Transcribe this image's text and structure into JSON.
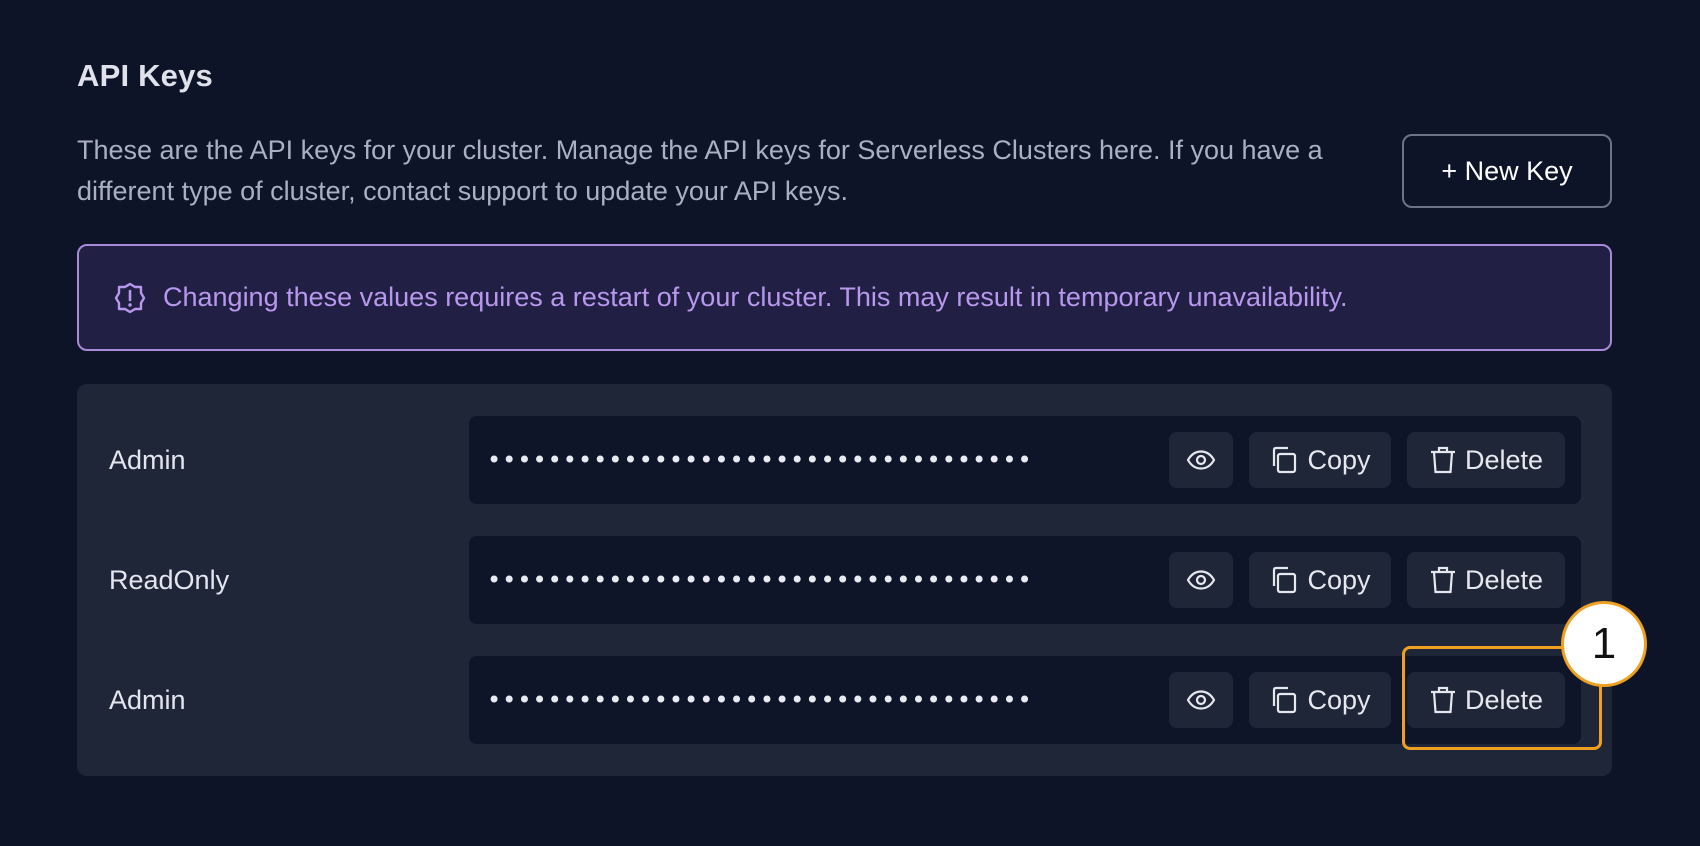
{
  "header": {
    "title": "API Keys",
    "description": "These are the API keys for your cluster. Manage the API keys for Serverless Clusters here. If you have a different type of cluster, contact support to update your API keys.",
    "new_key_label": "+ New Key"
  },
  "alert": {
    "text": "Changing these values requires a restart of your cluster. This may result in temporary unavailability.",
    "icon": "alert-circle-icon",
    "color": "#b898ec"
  },
  "keys": [
    {
      "label": "Admin",
      "masked_value": "••••••••••••••••••••••••••••••••••••",
      "copy_label": "Copy",
      "delete_label": "Delete"
    },
    {
      "label": "ReadOnly",
      "masked_value": "••••••••••••••••••••••••••••••••••••",
      "copy_label": "Copy",
      "delete_label": "Delete"
    },
    {
      "label": "Admin",
      "masked_value": "••••••••••••••••••••••••••••••••••••",
      "copy_label": "Copy",
      "delete_label": "Delete"
    }
  ],
  "annotation": {
    "callout_number": "1",
    "color": "#f0a020"
  },
  "colors": {
    "background": "#0e1428",
    "panel": "#1f2638",
    "field": "#0f1528",
    "alert_border": "#a88ad8",
    "alert_background": "#221f45"
  }
}
